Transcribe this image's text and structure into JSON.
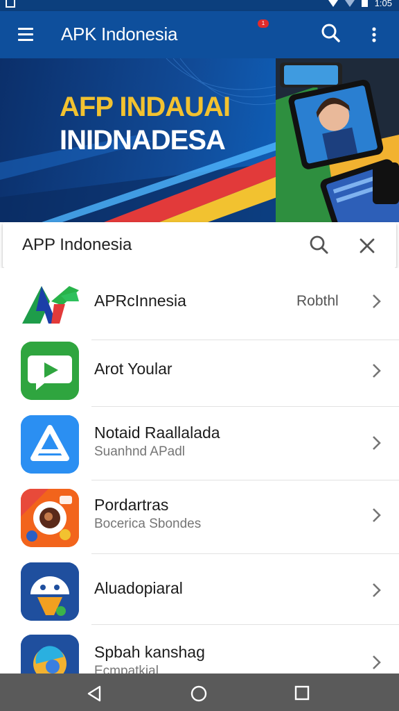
{
  "status_bar": {
    "time": "1:05",
    "icons": [
      "gallery-icon",
      "wifi-icon",
      "signal-icon",
      "battery-icon"
    ]
  },
  "app_bar": {
    "title": "APK Indonesia",
    "notification_count": "1",
    "icons": [
      "menu-icon",
      "search-icon",
      "more-vert-icon"
    ],
    "color": "#0e4f9c"
  },
  "banner": {
    "line1": "AFP INDAUAI",
    "line2": "INIDNADESA",
    "accent_color": "#f2c230"
  },
  "search": {
    "value": "APP Indonesia",
    "icons": [
      "search-icon",
      "close-icon"
    ]
  },
  "apps": [
    {
      "title": "APRcInnesia",
      "subtitle": "",
      "meta": "Robthl",
      "icon": "af-logo-icon"
    },
    {
      "title": "Arot Yoular",
      "subtitle": "",
      "meta": "",
      "icon": "play-chat-icon"
    },
    {
      "title": "Notaid Raallalada",
      "subtitle": "Suanhnd APadl",
      "meta": "",
      "icon": "triangle-a-icon"
    },
    {
      "title": "Pordartras",
      "subtitle": "Bocerica Sbondes",
      "meta": "",
      "icon": "coffee-cup-icon"
    },
    {
      "title": "Aluadopiaral",
      "subtitle": "",
      "meta": "",
      "icon": "android-face-icon"
    },
    {
      "title": "Spbah kanshag",
      "subtitle": "Ecmpatkial",
      "meta": "",
      "icon": "globe-icon"
    }
  ],
  "nav_bar": {
    "icons": [
      "back-icon",
      "home-icon",
      "recents-icon"
    ]
  }
}
